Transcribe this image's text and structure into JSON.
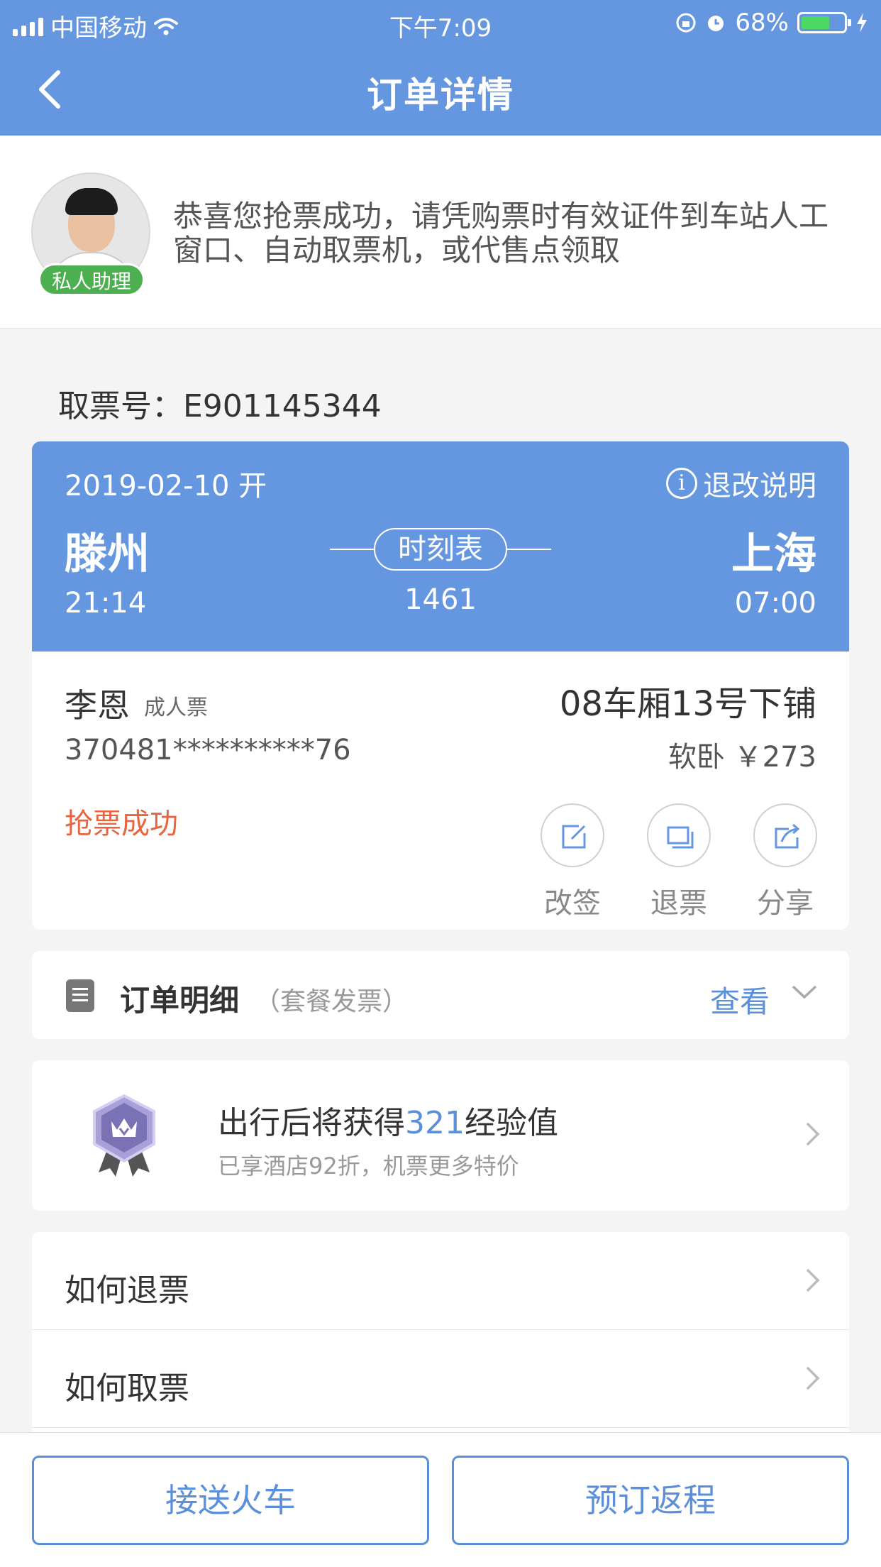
{
  "status_bar": {
    "carrier": "中国移动",
    "time": "下午7:09",
    "battery": "68%"
  },
  "header": {
    "title": "订单详情"
  },
  "assistant": {
    "badge": "私人助理",
    "message": "恭喜您抢票成功，请凭购票时有效证件到车站人工窗口、自动取票机，或代售点领取"
  },
  "pickup": {
    "label": "取票号：",
    "number": "E901145344"
  },
  "ticket": {
    "date": "2019-02-10 开",
    "refund_info": "退改说明",
    "from": "滕州",
    "to": "上海",
    "schedule_button": "时刻表",
    "departure_time": "21:14",
    "train_no": "1461",
    "arrival_time": "07:00",
    "passenger_name": "李恩",
    "ticket_type": "成人票",
    "seat": "08车厢13号下铺",
    "id_number": "370481**********76",
    "seat_class_price": "软卧 ￥273",
    "status": "抢票成功",
    "actions": {
      "change": "改签",
      "refund": "退票",
      "share": "分享"
    }
  },
  "order_detail": {
    "title": "订单明细",
    "subtitle": "（套餐发票）",
    "view": "查看"
  },
  "experience": {
    "title_before": "出行后将获得",
    "points": "321",
    "title_after": "经验值",
    "subtitle": "已享酒店92折，机票更多特价"
  },
  "howto": {
    "refund": "如何退票",
    "pickup": "如何取票"
  },
  "bottom": {
    "left_button": "接送火车",
    "right_button": "预订返程"
  },
  "colors": {
    "primary": "#6596e0",
    "link": "#5b8fd9",
    "success_status": "#e8643f",
    "badge_green": "#4caf50"
  }
}
